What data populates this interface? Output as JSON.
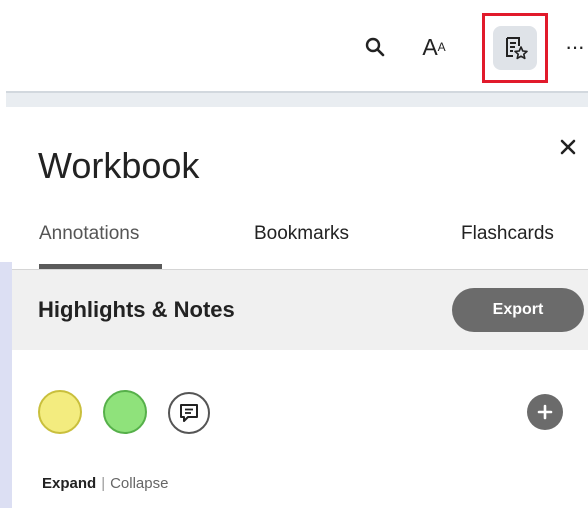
{
  "toolbar": {
    "search_icon": "search-icon",
    "font_size": {
      "big": "A",
      "small": "A"
    },
    "workbook_icon": "workbook-star-icon",
    "more_label": "···",
    "highlight_color": "#e11a2b"
  },
  "panel": {
    "title": "Workbook",
    "close_label": "×",
    "tabs": [
      {
        "label": "Annotations",
        "active": true
      },
      {
        "label": "Bookmarks",
        "active": false
      },
      {
        "label": "Flashcards",
        "active": false
      }
    ],
    "section": {
      "title": "Highlights & Notes",
      "export_label": "Export"
    },
    "filters": [
      {
        "name": "yellow",
        "color": "#f3ec7f"
      },
      {
        "name": "green",
        "color": "#8fe27b"
      },
      {
        "name": "notes",
        "icon": "note-icon"
      }
    ],
    "add_label": "+",
    "expand_label": "Expand",
    "separator": "|",
    "collapse_label": "Collapse"
  }
}
